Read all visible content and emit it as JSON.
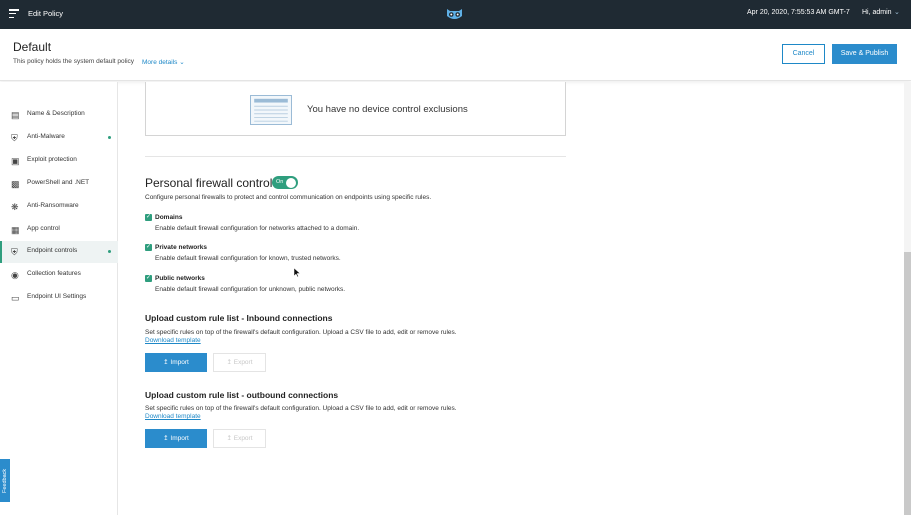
{
  "topbar": {
    "title": "Edit Policy",
    "datetime": "Apr 20, 2020, 7:55:53 AM GMT-7",
    "user": "Hi, admin",
    "menu_icon": "hamburger-icon",
    "logo_icon": "owl-logo-icon"
  },
  "header": {
    "title": "Default",
    "description": "This policy holds the system default policy",
    "more_details": "More details",
    "cancel_label": "Cancel",
    "save_label": "Save & Publish"
  },
  "sidebar": {
    "items": [
      {
        "label": "Name & Description",
        "icon": "document-icon",
        "active": false,
        "status": "none"
      },
      {
        "label": "Anti-Malware",
        "icon": "shield-icon",
        "active": false,
        "status": "enabled"
      },
      {
        "label": "Exploit protection",
        "icon": "exploit-icon",
        "active": false,
        "status": "none"
      },
      {
        "label": "PowerShell and .NET",
        "icon": "terminal-icon",
        "active": false,
        "status": "none"
      },
      {
        "label": "Anti-Ransomware",
        "icon": "bug-icon",
        "active": false,
        "status": "none"
      },
      {
        "label": "App control",
        "icon": "app-control-icon",
        "active": false,
        "status": "none"
      },
      {
        "label": "Endpoint controls",
        "icon": "shield-check-icon",
        "active": true,
        "status": "enabled"
      },
      {
        "label": "Collection features",
        "icon": "target-icon",
        "active": false,
        "status": "none"
      },
      {
        "label": "Endpoint UI Settings",
        "icon": "monitor-icon",
        "active": false,
        "status": "none"
      }
    ],
    "feedback_label": "Feedback"
  },
  "main": {
    "exclusions_empty": "You have no device control exclusions",
    "firewall": {
      "title": "Personal firewall control",
      "toggle_label": "On",
      "toggle_on": true,
      "description": "Configure personal firewalls to protect and control communication on endpoints using specific rules.",
      "options": [
        {
          "title": "Domains",
          "description": "Enable default firewall configuration for networks attached to a domain.",
          "checked": true
        },
        {
          "title": "Private networks",
          "description": "Enable default firewall configuration for known, trusted networks.",
          "checked": true
        },
        {
          "title": "Public networks",
          "description": "Enable default firewall configuration for unknown, public networks.",
          "checked": true
        }
      ]
    },
    "uploads": [
      {
        "title": "Upload custom rule list - Inbound connections",
        "description": "Set specific rules on top of the firewall's default configuration. Upload a CSV file to add, edit or remove rules.",
        "template_link": "Download template",
        "import_label": "Import",
        "export_label": "Export"
      },
      {
        "title": "Upload custom rule list - outbound connections",
        "description": "Set specific rules on top of the firewall's default configuration. Upload a CSV file to add, edit or remove rules.",
        "template_link": "Download template",
        "import_label": "Import",
        "export_label": "Export"
      }
    ]
  },
  "colors": {
    "topbar_bg": "#1f2a33",
    "accent_blue": "#2b8ccc",
    "accent_green": "#2f9e7e"
  }
}
